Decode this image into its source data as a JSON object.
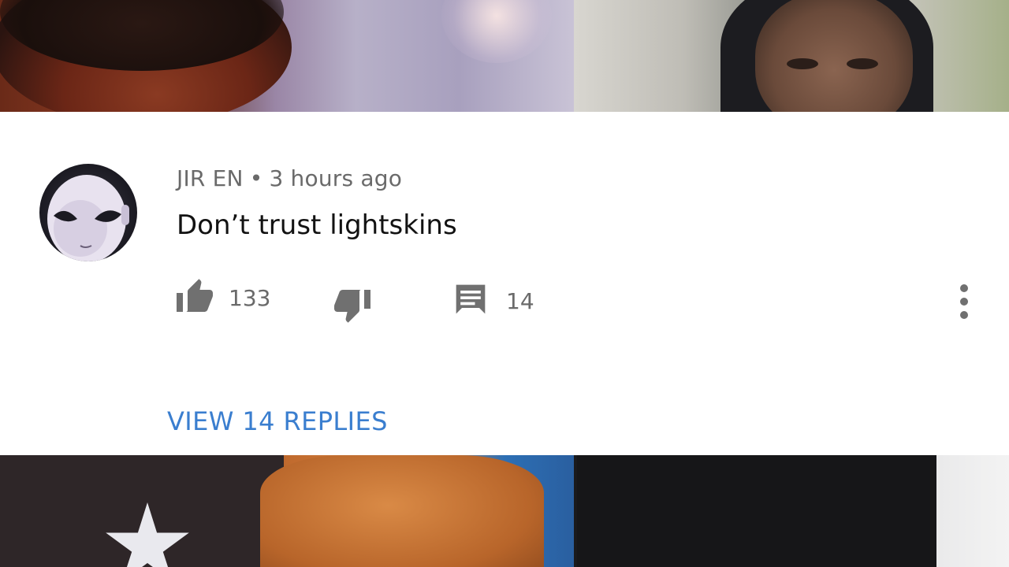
{
  "comment": {
    "author": "JIR EN",
    "separator": "•",
    "timestamp": "3 hours ago",
    "text": "Don’t trust lightskins",
    "likes": "133",
    "replies_count": "14",
    "view_replies_label": "VIEW 14 REPLIES"
  },
  "icons": {
    "like": "thumbs-up-icon",
    "dislike": "thumbs-down-icon",
    "reply": "comment-icon",
    "more": "more-vertical-icon"
  },
  "colors": {
    "link": "#3a7ecf",
    "meta_text": "#6a6a6a",
    "icon": "#707070",
    "card_bg": "#ffffff"
  }
}
